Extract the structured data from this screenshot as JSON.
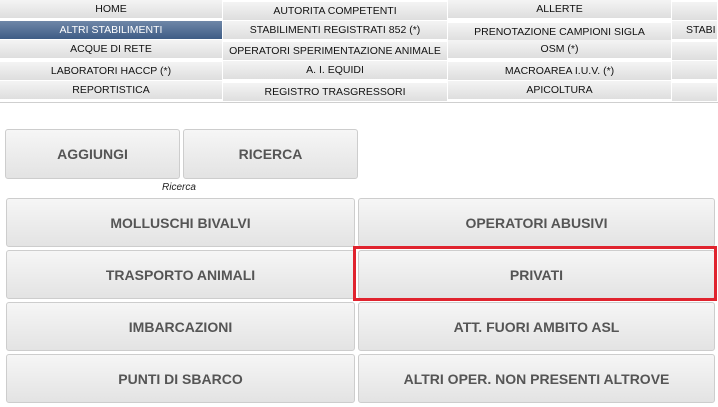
{
  "menu": {
    "rows": [
      [
        "HOME",
        "AUTORITA COMPETENTI",
        "ALLERTE",
        ""
      ],
      [
        "ALTRI STABILIMENTI",
        "STABILIMENTI REGISTRATI 852 (*)",
        "PRENOTAZIONE CAMPIONI SIGLA",
        "STABI"
      ],
      [
        "ACQUE DI RETE",
        "OPERATORI SPERIMENTAZIONE ANIMALE",
        "OSM (*)",
        ""
      ],
      [
        "LABORATORI HACCP (*)",
        "A. I. EQUIDI",
        "MACROAREA I.U.V. (*)",
        ""
      ],
      [
        "REPORTISTICA",
        "REGISTRO TRASGRESSORI",
        "APICOLTURA",
        ""
      ]
    ],
    "active": "ALTRI STABILIMENTI"
  },
  "actions": {
    "add_label": "AGGIUNGI",
    "search_label": "RICERCA",
    "search_caption": "Ricerca"
  },
  "categories": {
    "items": [
      "MOLLUSCHI BIVALVI",
      "OPERATORI ABUSIVI",
      "TRASPORTO ANIMALI",
      "PRIVATI",
      "IMBARCAZIONI",
      "ATT. FUORI AMBITO ASL",
      "PUNTI DI SBARCO",
      "ALTRI OPER. NON PRESENTI ALTROVE"
    ],
    "highlighted": "PRIVATI",
    "highlight_color": "#e0232e"
  }
}
